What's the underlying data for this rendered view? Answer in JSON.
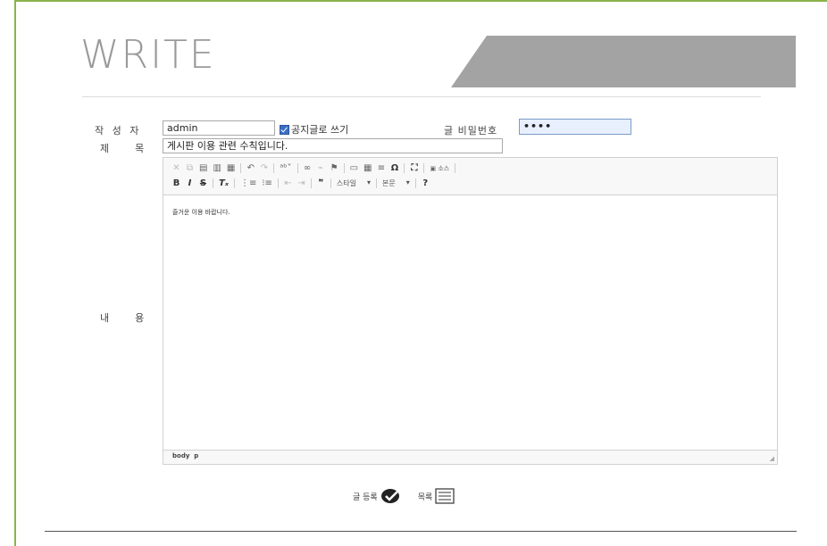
{
  "header": {
    "title": "WRITE"
  },
  "form": {
    "author_label": "작 성 자",
    "author_value": "admin",
    "notice_label": "공지글로 쓰기",
    "notice_checked": true,
    "password_label": "글 비밀번호",
    "password_value": "••••",
    "subject_label": "제    목",
    "subject_value": "게시판 이용 관련 수칙입니다.",
    "content_label": "내    용"
  },
  "editor": {
    "toolbar_row1": [
      "cut-icon",
      "copy-icon",
      "paste-icon",
      "paste-text-icon",
      "paste-word-icon",
      "undo-icon",
      "redo-icon",
      "spellcheck-icon",
      "link-icon",
      "unlink-icon",
      "anchor-icon",
      "image-icon",
      "table-icon",
      "hr-icon",
      "special-char-icon",
      "maximize-icon",
      "source-icon"
    ],
    "source_label": "소스",
    "style_combo": "스타일",
    "format_combo": "본문",
    "content_text": "즐거운 이용 바랍니다.",
    "status_path": "body  p"
  },
  "actions": {
    "submit_label": "글 등록",
    "list_label": "목록"
  },
  "colors": {
    "frame": "#8ab34a",
    "banner": "#a0a0a0"
  }
}
